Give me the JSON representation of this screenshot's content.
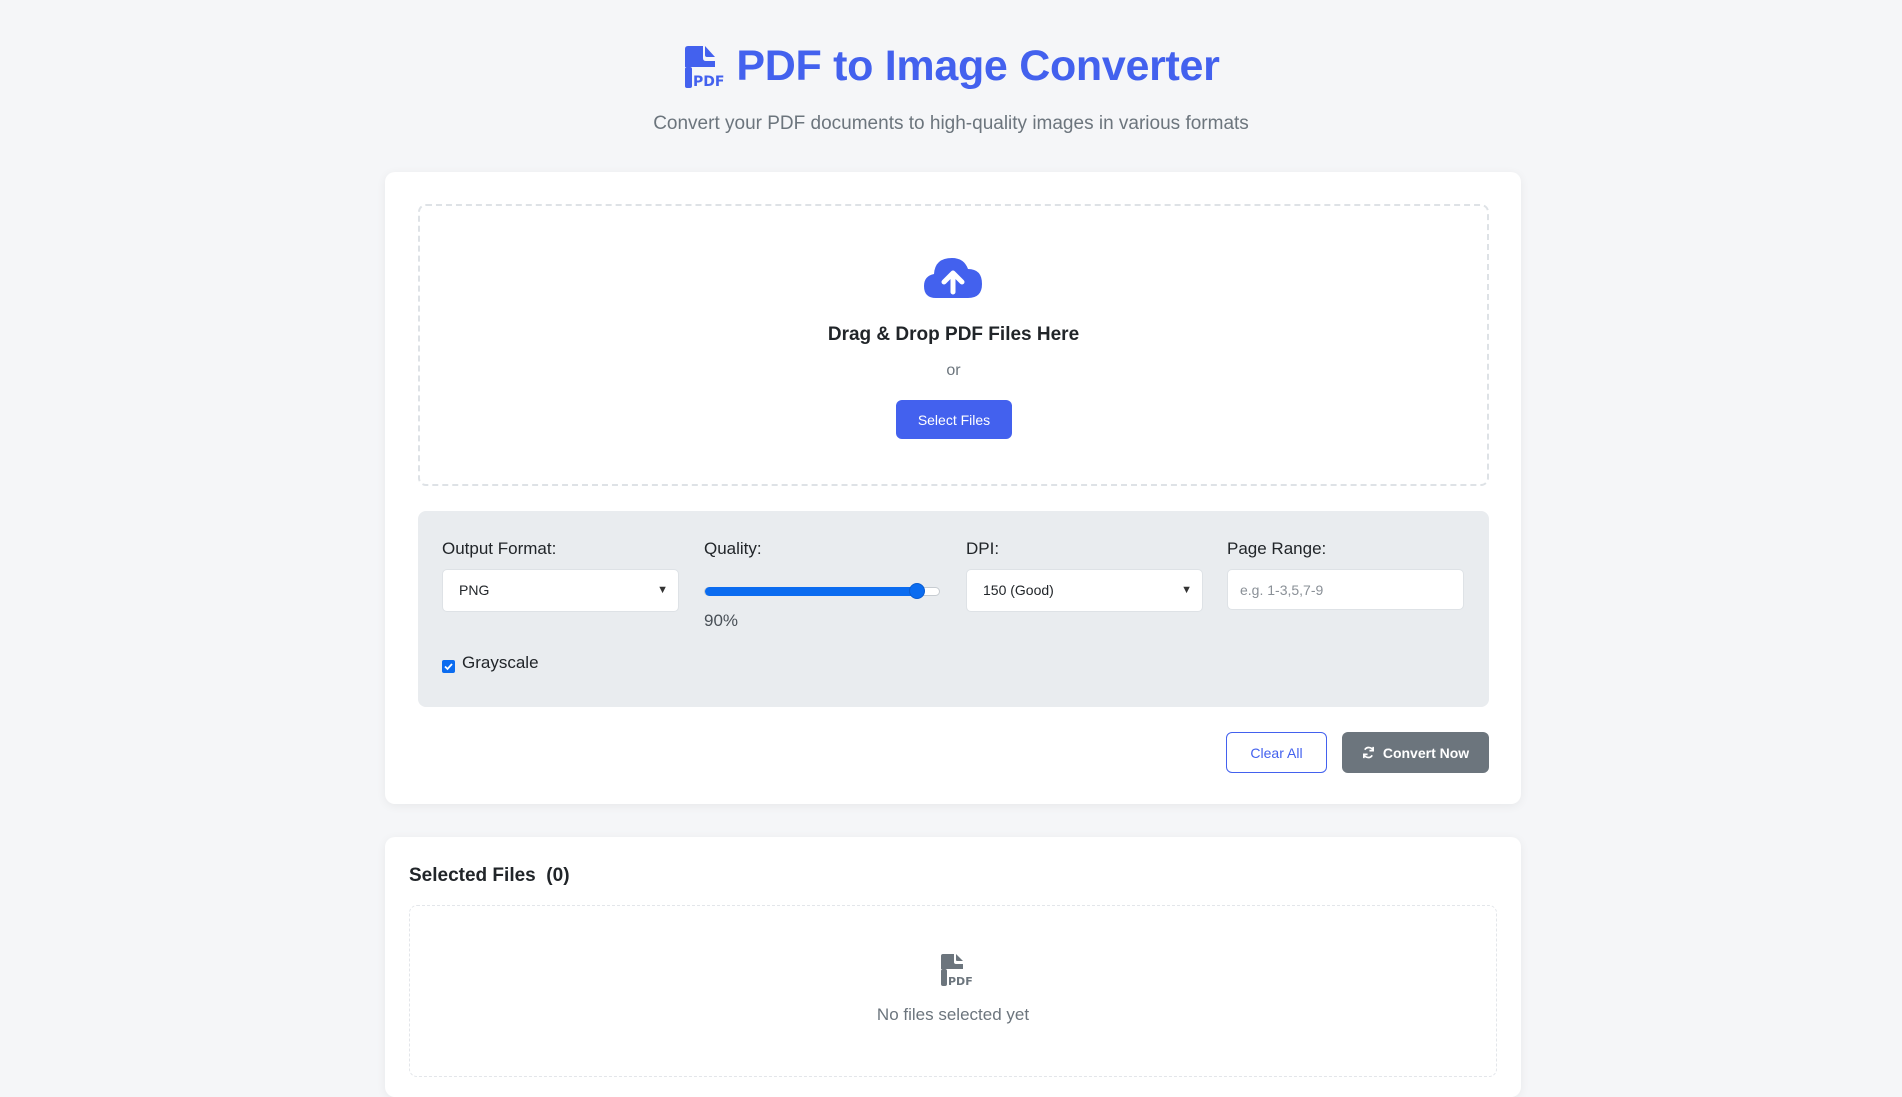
{
  "header": {
    "title": "PDF to Image Converter",
    "subtitle": "Convert your PDF documents to high-quality images in various formats",
    "icon": "file-pdf-icon",
    "accent_color": "#4361ee"
  },
  "dropzone": {
    "icon": "cloud-upload-icon",
    "title": "Drag & Drop PDF Files Here",
    "or_text": "or",
    "select_label": "Select Files"
  },
  "options": {
    "output_format": {
      "label": "Output Format:",
      "value": "PNG"
    },
    "quality": {
      "label": "Quality:",
      "value_text": "90%",
      "level": 0.9
    },
    "dpi": {
      "label": "DPI:",
      "value": "150 (Good)"
    },
    "page_range": {
      "label": "Page Range:",
      "placeholder": "e.g. 1-3,5,7-9",
      "value": ""
    },
    "grayscale": {
      "label": "Grayscale",
      "checked": true
    }
  },
  "actions": {
    "clear_label": "Clear All",
    "convert_label": "Convert Now",
    "convert_icon": "sync-icon"
  },
  "files": {
    "title": "Selected Files",
    "count": "(0)",
    "empty_icon": "file-pdf-icon",
    "empty_text": "No files selected yet"
  }
}
